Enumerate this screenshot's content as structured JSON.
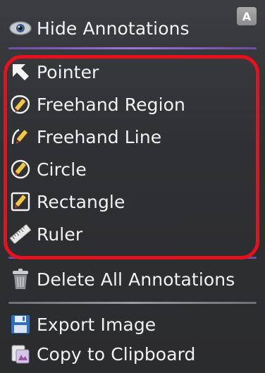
{
  "menu": {
    "hide_annotations": {
      "label": "Hide Annotations",
      "icon": "eye-icon",
      "shortcut": "A"
    },
    "tools": [
      {
        "label": "Pointer",
        "icon": "pointer-arrow-icon"
      },
      {
        "label": "Freehand Region",
        "icon": "freehand-region-icon"
      },
      {
        "label": "Freehand Line",
        "icon": "freehand-line-icon"
      },
      {
        "label": "Circle",
        "icon": "circle-pencil-icon"
      },
      {
        "label": "Rectangle",
        "icon": "rectangle-pencil-icon"
      },
      {
        "label": "Ruler",
        "icon": "ruler-icon"
      }
    ],
    "delete_all": {
      "label": "Delete All Annotations",
      "icon": "trash-icon"
    },
    "export_image": {
      "label": "Export Image",
      "icon": "save-disk-icon"
    },
    "copy_clipboard": {
      "label": "Copy to Clipboard",
      "icon": "clipboard-copy-icon"
    }
  },
  "colors": {
    "menu_background": "#2f3033",
    "text": "#f2f2f2",
    "separator_accent": "#9a78d8",
    "highlight_outline": "#e8101a"
  }
}
